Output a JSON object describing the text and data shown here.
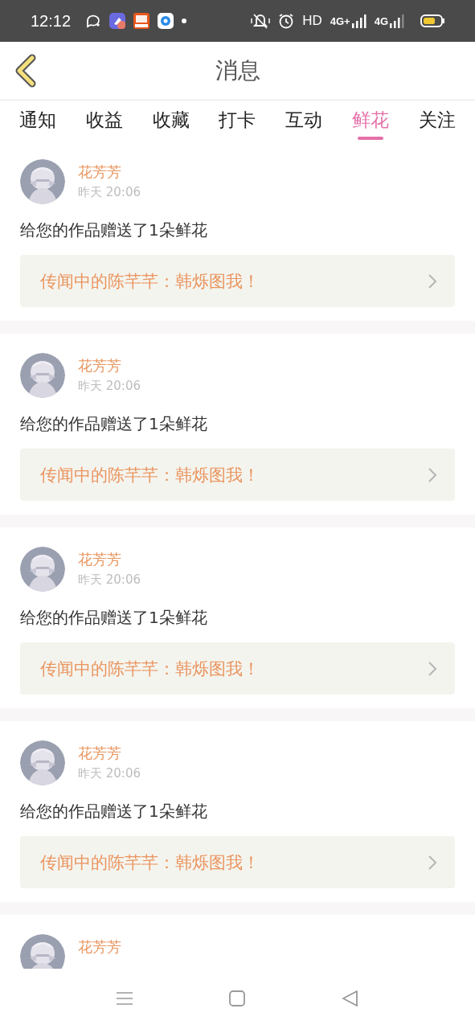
{
  "status_bar": {
    "time": "12:12",
    "hd_label": "HD",
    "network_labels": [
      "4G+",
      "4G"
    ]
  },
  "header": {
    "title": "消息"
  },
  "tabs": [
    {
      "label": "通知",
      "selected": false
    },
    {
      "label": "收益",
      "selected": false
    },
    {
      "label": "收藏",
      "selected": false
    },
    {
      "label": "打卡",
      "selected": false
    },
    {
      "label": "互动",
      "selected": false
    },
    {
      "label": "鲜花",
      "selected": true
    },
    {
      "label": "关注",
      "selected": false
    }
  ],
  "messages": [
    {
      "name": "花芳芳",
      "time": "昨天 20:06",
      "text": "给您的作品赠送了1朵鲜花",
      "work": "传闻中的陈芊芊：韩烁图我！"
    },
    {
      "name": "花芳芳",
      "time": "昨天 20:06",
      "text": "给您的作品赠送了1朵鲜花",
      "work": "传闻中的陈芊芊：韩烁图我！"
    },
    {
      "name": "花芳芳",
      "time": "昨天 20:06",
      "text": "给您的作品赠送了1朵鲜花",
      "work": "传闻中的陈芊芊：韩烁图我！"
    },
    {
      "name": "花芳芳",
      "time": "昨天 20:06",
      "text": "给您的作品赠送了1朵鲜花",
      "work": "传闻中的陈芊芊：韩烁图我！"
    },
    {
      "name": "花芳芳"
    }
  ]
}
